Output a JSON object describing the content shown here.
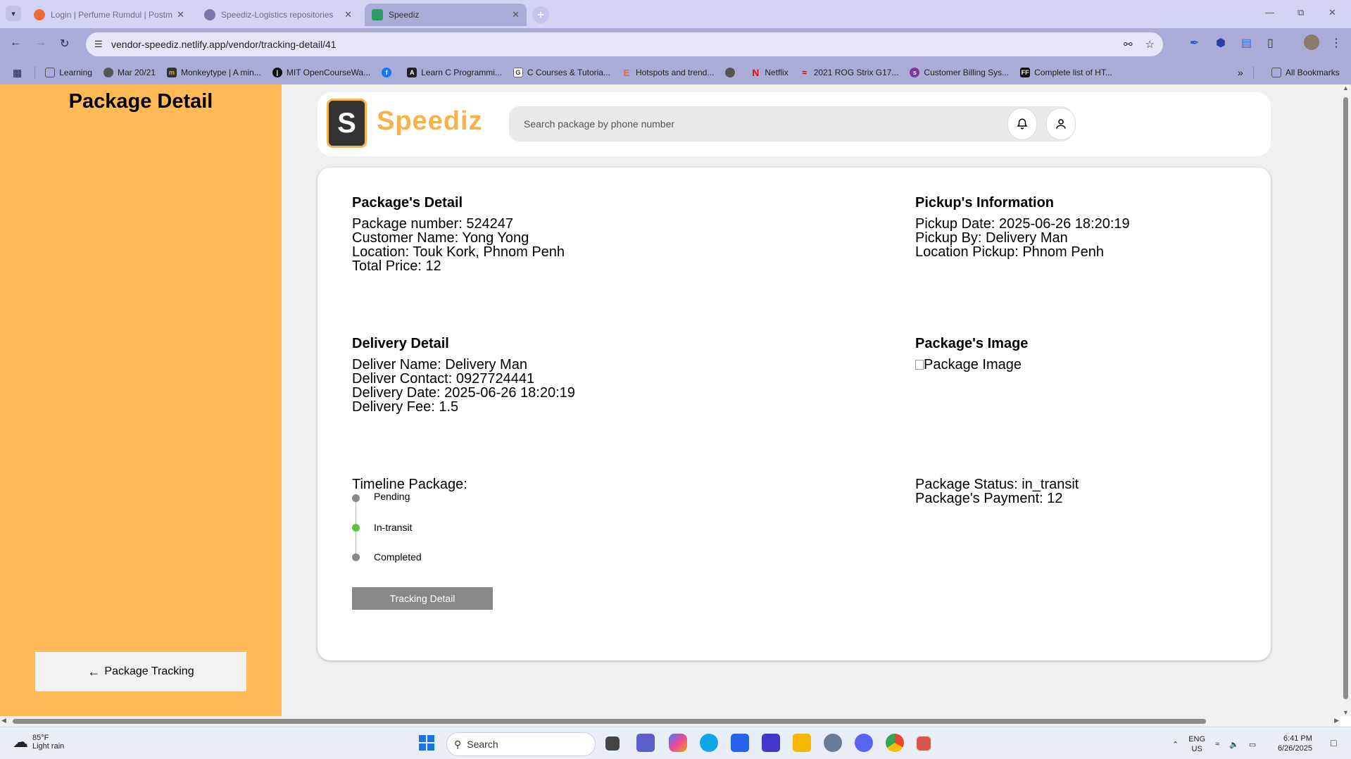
{
  "browser": {
    "tabs": [
      {
        "title": "Login | Perfume Rumdul | Postm",
        "active": false,
        "favicon_color": "#f06a3a"
      },
      {
        "title": "Speediz-Logistics repositories",
        "active": false,
        "favicon_color": "#7777aa"
      },
      {
        "title": "Speediz",
        "active": true,
        "favicon_color": "#2a9d6a"
      }
    ],
    "url": "vendor-speediz.netlify.app/vendor/tracking-detail/41",
    "bookmarks": [
      {
        "label": "Learning",
        "icon": "folder-icon",
        "color": "#666"
      },
      {
        "label": "Mar 20/21",
        "icon": "globe-icon",
        "color": "#555"
      },
      {
        "label": "Monkeytype | A min...",
        "icon": "monkeytype-icon",
        "color": "#333"
      },
      {
        "label": "MIT OpenCourseWa...",
        "icon": "mit-icon",
        "color": "#111"
      },
      {
        "label": "",
        "icon": "facebook-icon",
        "color": "#1877f2"
      },
      {
        "label": "Learn C Programmi...",
        "icon": "learnc-icon",
        "color": "#222"
      },
      {
        "label": "C Courses & Tutoria...",
        "icon": "g-icon",
        "color": "#555"
      },
      {
        "label": "Hotspots and trend...",
        "icon": "e-icon",
        "color": "#e07030"
      },
      {
        "label": "",
        "icon": "globe-icon",
        "color": "#555"
      },
      {
        "label": "Netflix",
        "icon": "netflix-icon",
        "color": "#e50914"
      },
      {
        "label": "2021 ROG Strix G17...",
        "icon": "rog-icon",
        "color": "#c00"
      },
      {
        "label": "Customer Billing Sys...",
        "icon": "sl-icon",
        "color": "#7a3b9a"
      },
      {
        "label": "Complete list of HT...",
        "icon": "ff-icon",
        "color": "#111"
      }
    ],
    "all_bookmarks": "All Bookmarks"
  },
  "sidebar": {
    "title": "Package Detail",
    "back_label": "Package Tracking"
  },
  "header": {
    "logo_letter": "S",
    "logo_text": "Speediz",
    "search_placeholder": "Search package by phone number"
  },
  "package_detail": {
    "heading": "Package's Detail",
    "lines": [
      "Package number: 524247",
      "Customer Name: Yong Yong",
      "Location: Touk Kork, Phnom Penh",
      "Total Price: 12"
    ]
  },
  "pickup_info": {
    "heading": "Pickup's Information",
    "lines": [
      "Pickup Date: 2025-06-26 18:20:19",
      "Pickup By: Delivery Man",
      "Location Pickup: Phnom Penh"
    ]
  },
  "delivery_detail": {
    "heading": "Delivery Detail",
    "lines": [
      "Deliver Name: Delivery Man",
      "Deliver Contact: 0927724441",
      "Delivery Date: 2025-06-26 18:20:19",
      "Delivery Fee: 1.5"
    ]
  },
  "package_image": {
    "heading": "Package's Image",
    "alt": "Package Image"
  },
  "timeline": {
    "label": "Timeline Package:",
    "steps": [
      {
        "label": "Pending",
        "active": false
      },
      {
        "label": "In-transit",
        "active": true
      },
      {
        "label": "Completed",
        "active": false
      }
    ],
    "button_label": "Tracking Detail"
  },
  "status": {
    "lines": [
      "Package Status: in_transit",
      "Package's Payment: 12"
    ]
  },
  "colors": {
    "sidebar": "#ffba57",
    "brand": "#f7b34a",
    "active_step": "#5cc23a"
  },
  "taskbar": {
    "weather_temp": "85°F",
    "weather_desc": "Light rain",
    "search_label": "Search",
    "lang_top": "ENG",
    "lang_bottom": "US",
    "time": "6:41 PM",
    "date": "6/26/2025"
  }
}
